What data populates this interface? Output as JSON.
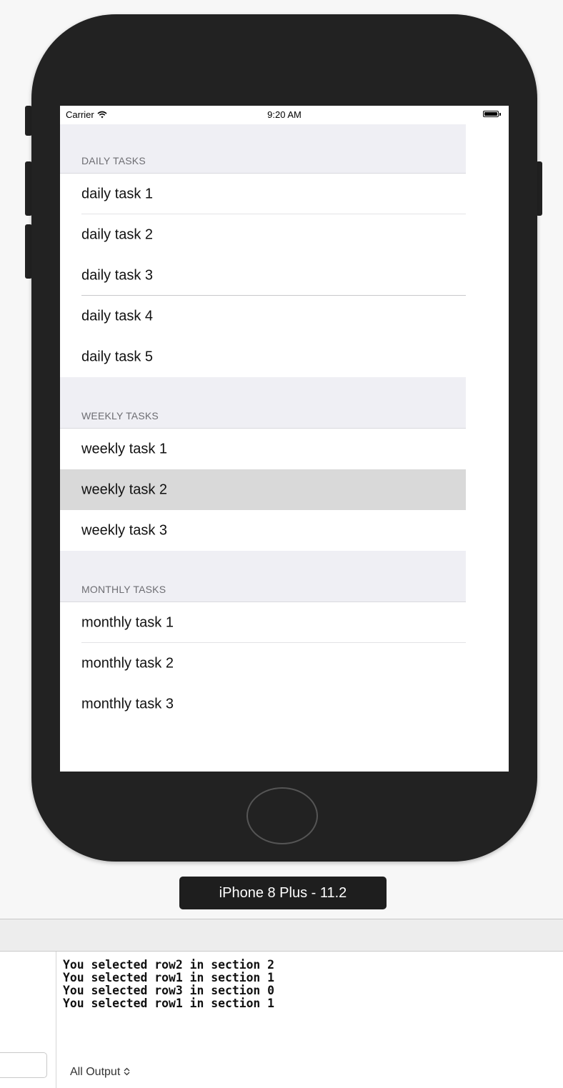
{
  "status_bar": {
    "carrier": "Carrier",
    "time": "9:20 AM"
  },
  "sections": [
    {
      "title": "DAILY TASKS",
      "rows": [
        "daily task 1",
        "daily task 2",
        "daily task 3",
        "daily task 4",
        "daily task 5"
      ]
    },
    {
      "title": "WEEKLY TASKS",
      "rows": [
        "weekly task 1",
        "weekly task 2",
        "weekly task 3"
      ]
    },
    {
      "title": "MONTHLY TASKS",
      "rows": [
        "monthly task 1",
        "monthly task 2",
        "monthly task 3"
      ]
    }
  ],
  "selected_row": "weekly task 2",
  "device_label": "iPhone 8 Plus - 11.2",
  "console_lines": [
    "You selected row2 in section 2",
    "You selected row1 in section 1",
    "You selected row3 in section 0",
    "You selected row1 in section 1"
  ],
  "output_filter": "All Output",
  "icons": {
    "wifi": "wifi-icon",
    "battery": "battery-icon",
    "home": "home-button-icon",
    "stepper": "up-down-chevron-icon"
  },
  "colors": {
    "section_header_bg": "#efeff4",
    "selected_row_bg": "#d9d9d9",
    "device_body": "#222222"
  }
}
